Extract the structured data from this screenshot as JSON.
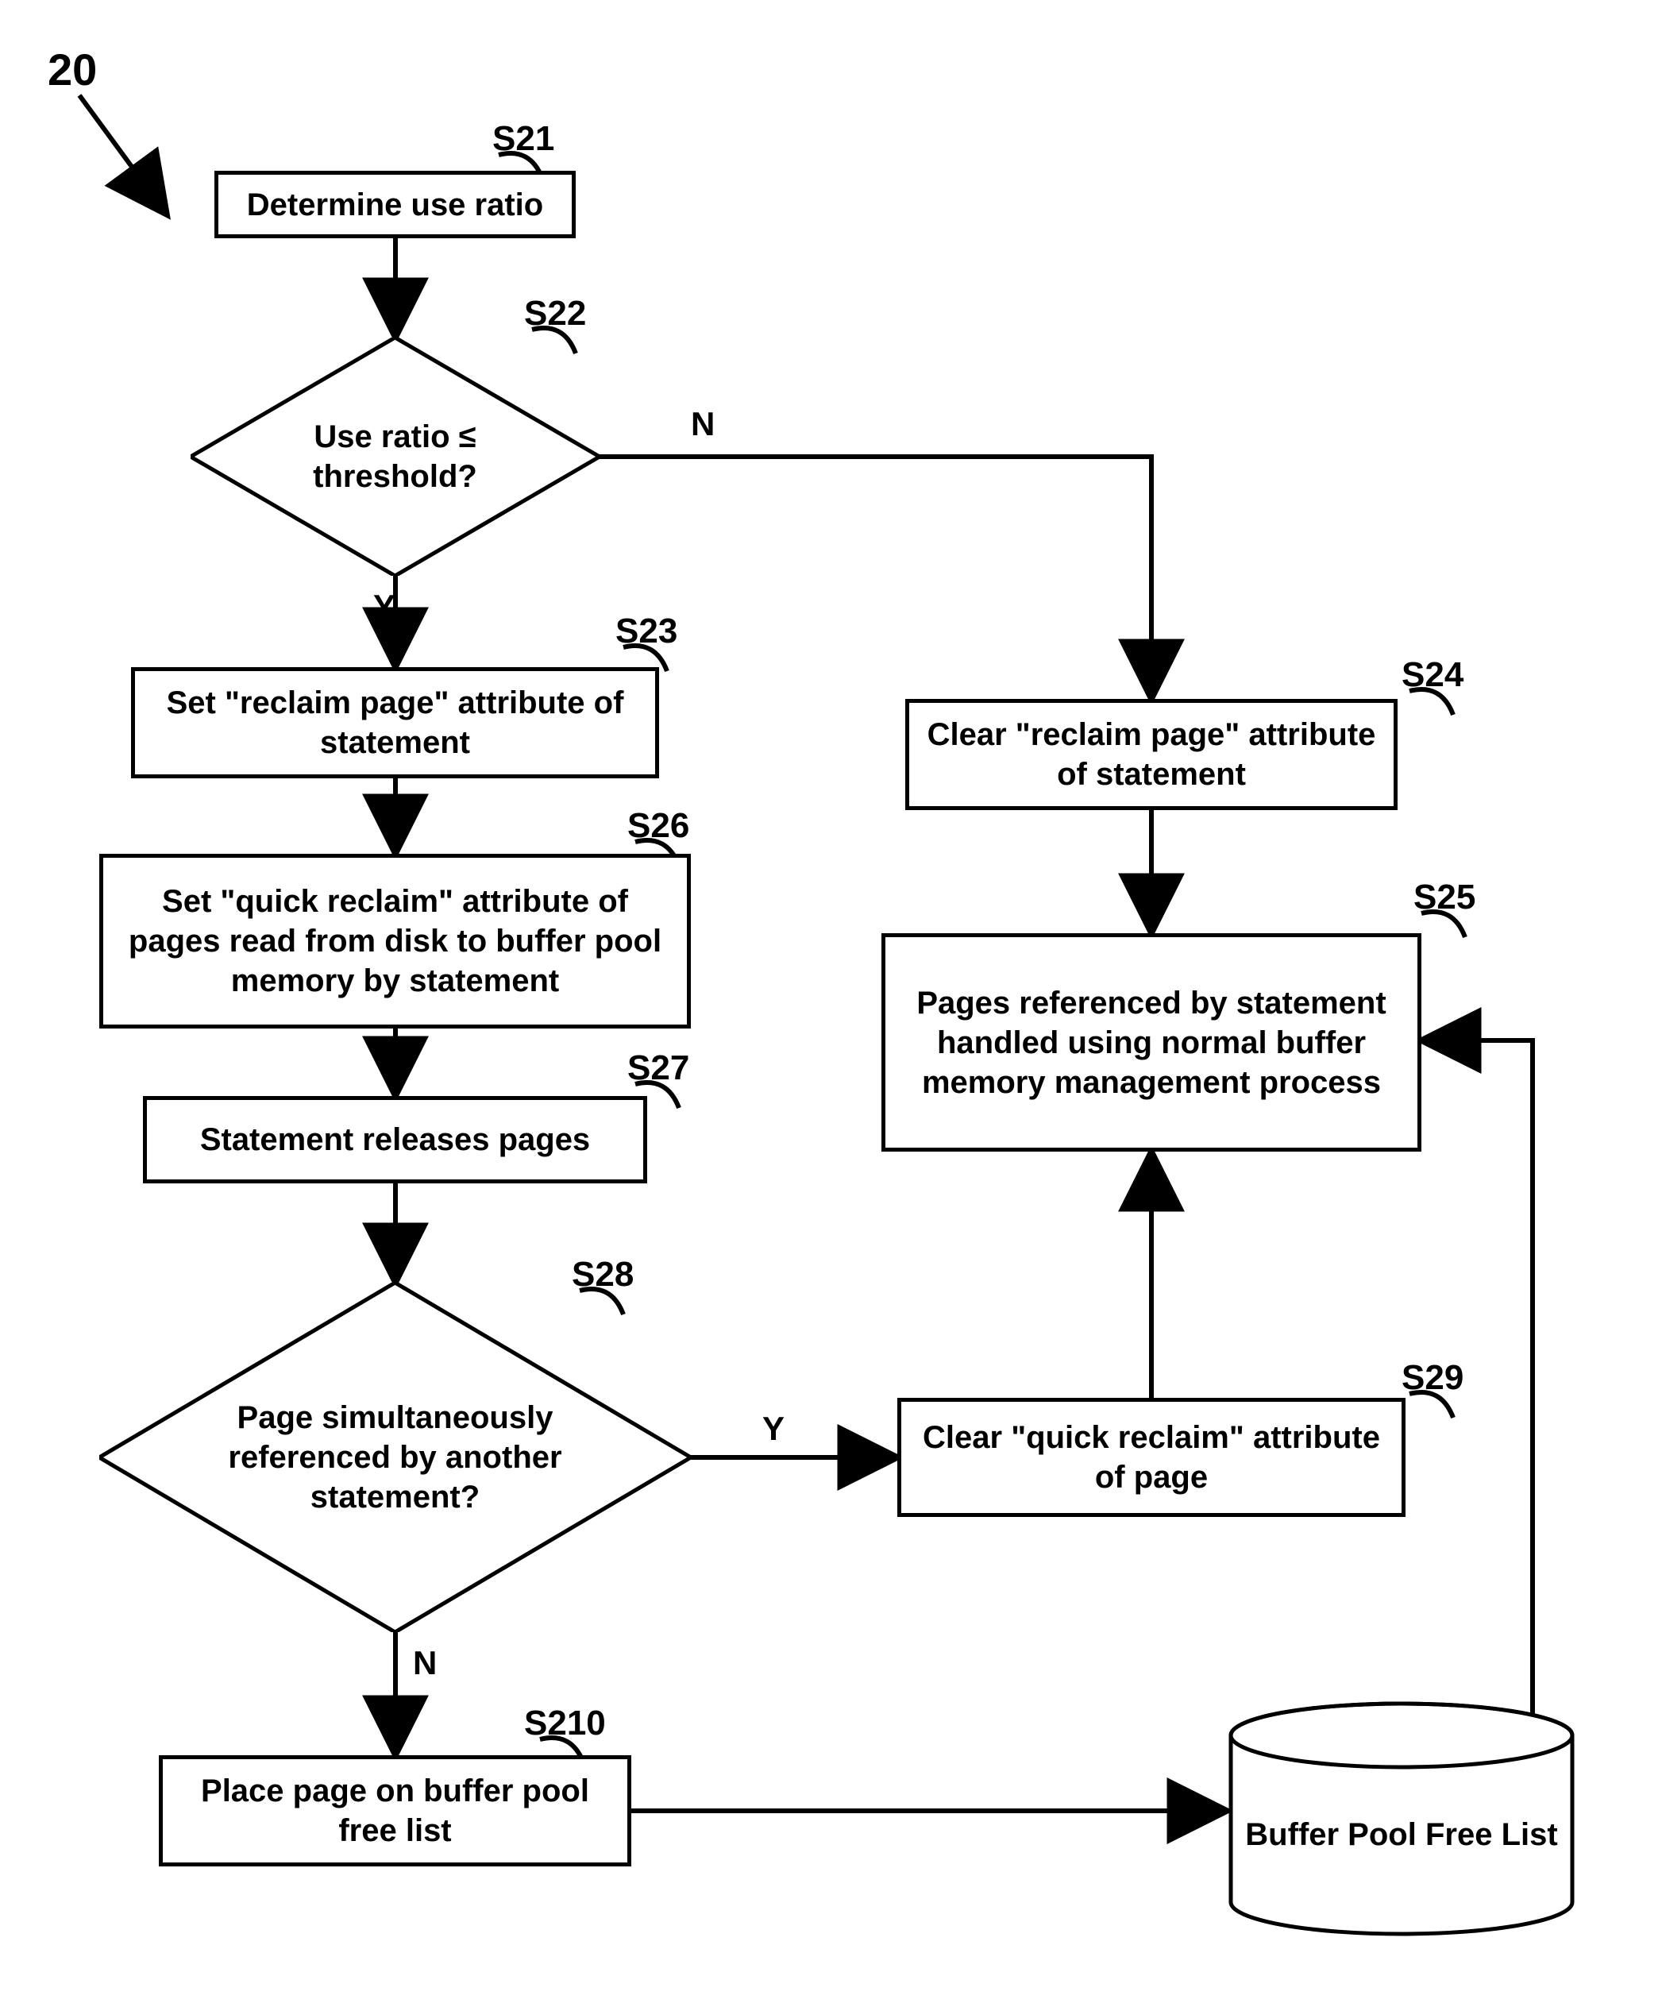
{
  "figure": {
    "number_label": "20"
  },
  "steps": {
    "s21": {
      "tag": "S21",
      "text": "Determine use ratio"
    },
    "s22": {
      "tag": "S22",
      "text": "Use ratio ≤ threshold?",
      "yes": "Y",
      "no": "N"
    },
    "s23": {
      "tag": "S23",
      "text": "Set \"reclaim page\" attribute of statement"
    },
    "s24": {
      "tag": "S24",
      "text": "Clear \"reclaim page\" attribute of statement"
    },
    "s25": {
      "tag": "S25",
      "text": "Pages referenced by statement handled using normal buffer memory management process"
    },
    "s26": {
      "tag": "S26",
      "text": "Set \"quick reclaim\" attribute of pages read from disk to buffer pool memory by statement"
    },
    "s27": {
      "tag": "S27",
      "text": "Statement releases pages"
    },
    "s28": {
      "tag": "S28",
      "text": "Page simultaneously referenced by another statement?",
      "yes": "Y",
      "no": "N"
    },
    "s29": {
      "tag": "S29",
      "text": "Clear \"quick reclaim\" attribute of page"
    },
    "s210": {
      "tag": "S210",
      "text": "Place page on buffer pool free list"
    }
  },
  "store": {
    "buffer_pool_free_list": "Buffer Pool Free List"
  }
}
